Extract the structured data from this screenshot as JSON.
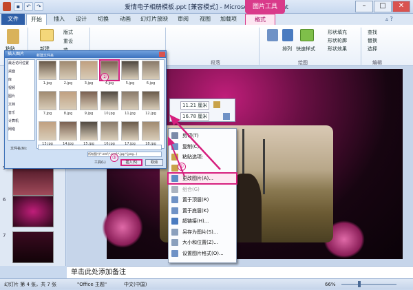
{
  "window": {
    "title": "爱情电子相册模板.ppt [兼容模式] - Microsoft PowerPoint",
    "context_tab": "图片工具"
  },
  "tabs": [
    "文件",
    "开始",
    "插入",
    "设计",
    "切换",
    "动画",
    "幻灯片放映",
    "审阅",
    "视图",
    "加载项",
    "格式"
  ],
  "ribbon": {
    "paste": "粘贴",
    "new": "新建",
    "layout": "版式",
    "reset": "重设",
    "section": "节",
    "arrange": "排列",
    "quick_styles": "快速样式",
    "shape_fill": "形状填充",
    "shape_outline": "形状轮廓",
    "shape_effects": "形状效果",
    "find": "查找",
    "replace": "替换",
    "select": "选择",
    "groups": [
      "段落",
      "绘图",
      "编辑"
    ]
  },
  "slides": [
    {
      "num": "5",
      "col": "#6a2a3a"
    },
    {
      "num": "6",
      "col": "#7a1e56"
    },
    {
      "num": "7",
      "col": "#3a0a20"
    }
  ],
  "size_toolbar": {
    "height": "11.21 厘米",
    "width": "16.78 厘米"
  },
  "context_menu": [
    {
      "label": "剪切(T)",
      "icon": "scissors-icon",
      "color": "#7a8aa8",
      "disabled": false
    },
    {
      "label": "复制(C)",
      "icon": "copy-icon",
      "color": "#6f92c6",
      "disabled": false
    },
    {
      "label": "粘贴选项:",
      "icon": "paste-icon",
      "color": "#c9a34a",
      "disabled": false
    },
    {
      "label": "",
      "icon": "paste-option-icon",
      "color": "#c9a34a",
      "disabled": false
    },
    {
      "label": "更改图片(A)...",
      "icon": "change-picture-icon",
      "color": "#5e8cc6",
      "disabled": false
    },
    {
      "label": "组合(G)",
      "icon": "group-icon",
      "color": "#aab3c0",
      "disabled": true
    },
    {
      "label": "置于顶层(R)",
      "icon": "bring-front-icon",
      "color": "#6f92c6",
      "disabled": false
    },
    {
      "label": "置于底层(K)",
      "icon": "send-back-icon",
      "color": "#6f92c6",
      "disabled": false
    },
    {
      "label": "超链接(H)...",
      "icon": "hyperlink-icon",
      "color": "#4a7bc0",
      "disabled": false
    },
    {
      "label": "另存为图片(S)...",
      "icon": "save-picture-icon",
      "color": "#8ba0bd",
      "disabled": false
    },
    {
      "label": "大小和位置(Z)...",
      "icon": "size-position-icon",
      "color": "#8ba0bd",
      "disabled": false
    },
    {
      "label": "设置图片格式(O)...",
      "icon": "format-picture-icon",
      "color": "#6f92c6",
      "disabled": false
    }
  ],
  "dialog": {
    "title": "插入图片",
    "breadcrumb": "新建文件夹",
    "nav": [
      "最近访问位置",
      "桌面",
      "库",
      "视频",
      "图片",
      "文档",
      "音乐",
      "计算机",
      "网络"
    ],
    "files": [
      "1.jpg",
      "2.jpg",
      "3.jpg",
      "4.jpg",
      "5.jpg",
      "6.jpg",
      "7.jpg",
      "8.jpg",
      "9.jpg",
      "10.jpg",
      "11.jpg",
      "12.jpg",
      "13.jpg",
      "14.jpg",
      "15.jpg",
      "16.jpg",
      "17.jpg",
      "18.jpg"
    ],
    "file_name_label": "文件名(N):",
    "file_type_label": "所有图片(*.emf;*.wmf;*.jpg;*.jpeg...)",
    "tools": "工具(L)",
    "insert": "插入(S)",
    "cancel": "取消"
  },
  "callouts": [
    "①",
    "②",
    "③"
  ],
  "notes_placeholder": "单击此处添加备注",
  "status": {
    "slide": "幻灯片 第 4 张，共 7 张",
    "theme": "\"Office 主题\"",
    "lang": "中文(中国)",
    "zoom": "66%"
  },
  "colors": {
    "accent": "#d61f7e"
  }
}
